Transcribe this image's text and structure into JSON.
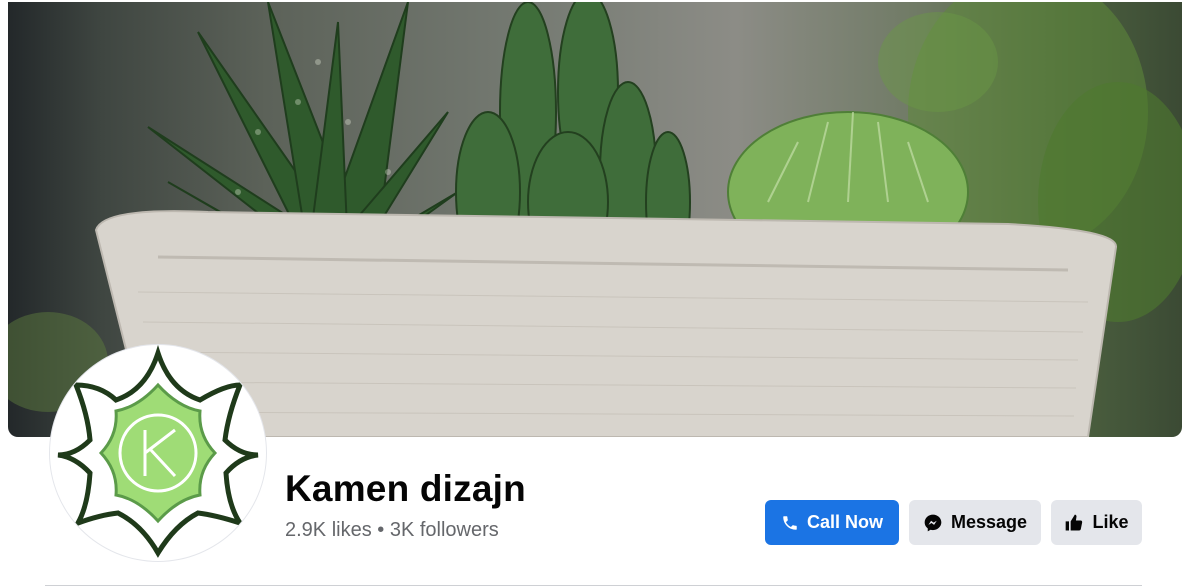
{
  "page": {
    "name": "Kamen dizajn",
    "likes": "2.9K likes",
    "separator": " • ",
    "followers": "3K followers"
  },
  "actions": {
    "call_label": "Call Now",
    "message_label": "Message",
    "like_label": "Like"
  },
  "icons": {
    "call": "phone-icon",
    "message": "messenger-icon",
    "like": "thumbs-up-icon"
  },
  "colors": {
    "primary_button": "#1b74e4",
    "secondary_button": "#e4e6eb",
    "title_text": "#050505",
    "meta_text": "#65676b",
    "logo_dark": "#1f3a1a",
    "logo_light": "#6cc04a"
  }
}
